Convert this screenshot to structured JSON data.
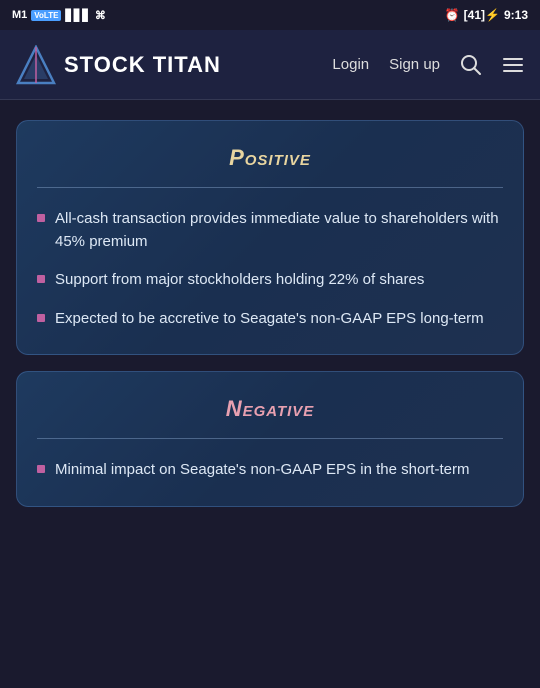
{
  "statusBar": {
    "carrier": "M1",
    "connectionType": "VoLTE",
    "time": "9:13",
    "batteryLevel": "41"
  },
  "navbar": {
    "appName": "STOCK TITAN",
    "loginLabel": "Login",
    "signupLabel": "Sign up"
  },
  "positiveCard": {
    "title": "Positive",
    "items": [
      "All-cash transaction provides immediate value to shareholders with 45% premium",
      "Support from major stockholders holding 22% of shares",
      "Expected to be accretive to Seagate's non-GAAP EPS long-term"
    ]
  },
  "negativeCard": {
    "title": "Negative",
    "items": [
      "Minimal impact on Seagate's non-GAAP EPS in the short-term"
    ]
  }
}
